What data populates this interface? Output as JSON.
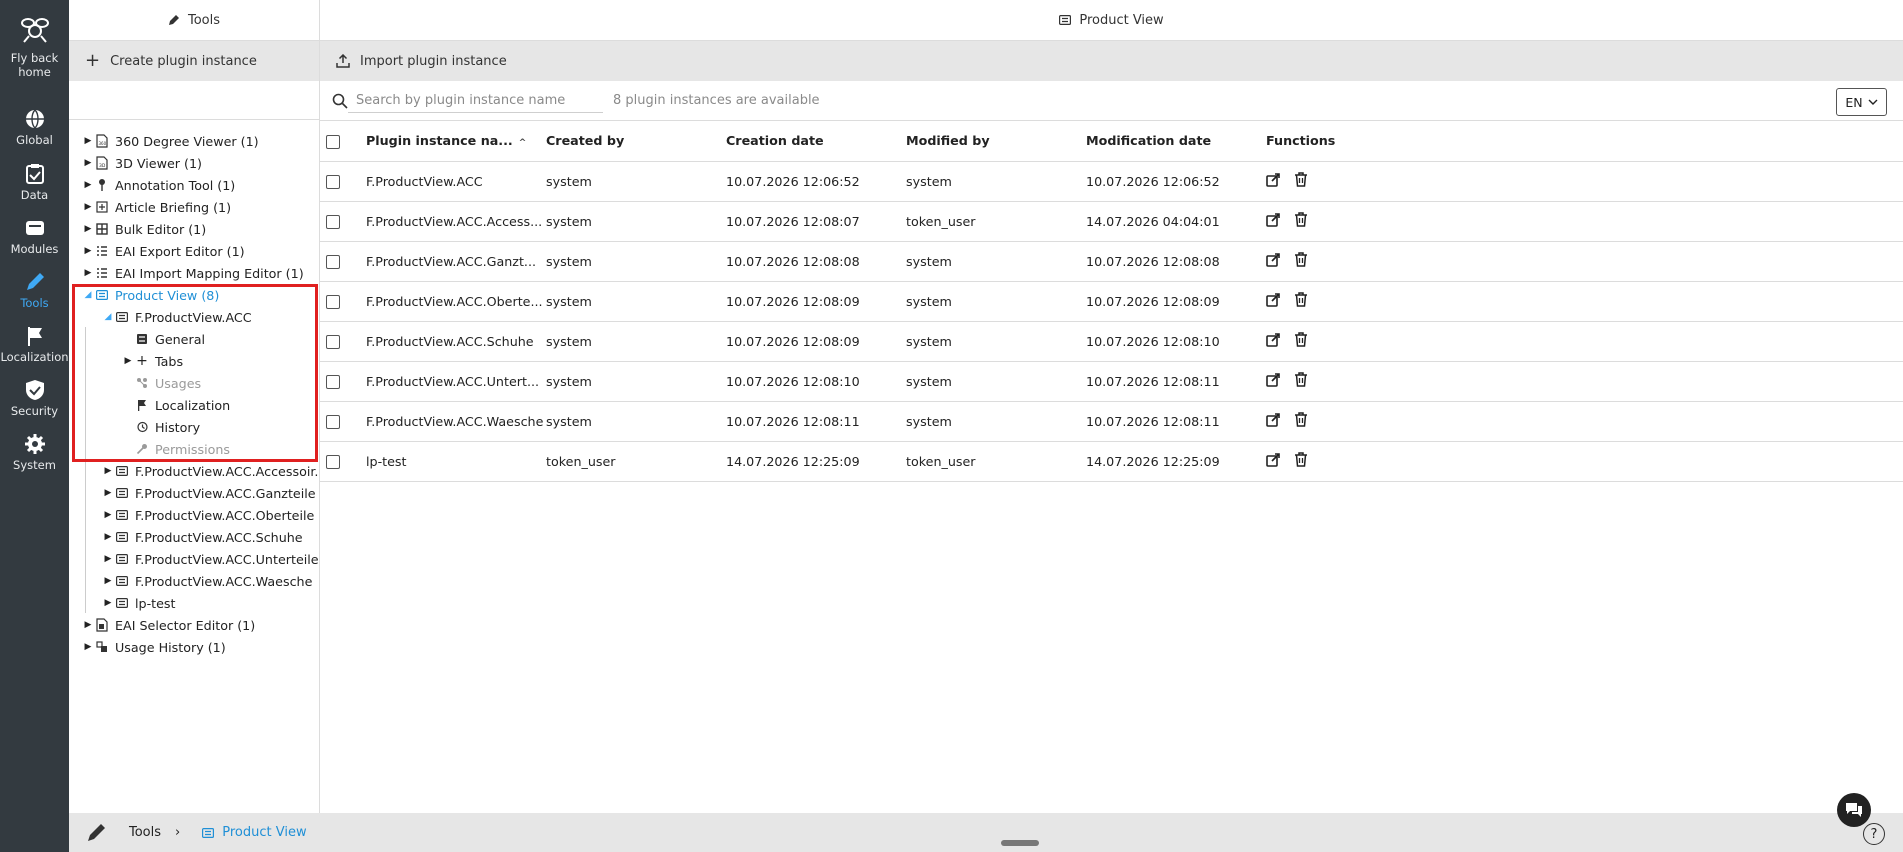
{
  "rail": [
    {
      "label": "Fly back home",
      "icon": "bee-logo-icon"
    },
    {
      "label": "Global",
      "icon": "globe-icon"
    },
    {
      "label": "Data",
      "icon": "clipboard-check-icon"
    },
    {
      "label": "Modules",
      "icon": "module-card-icon"
    },
    {
      "label": "Tools",
      "icon": "pencil-icon",
      "active": true
    },
    {
      "label": "Localization",
      "icon": "flag-icon"
    },
    {
      "label": "Security",
      "icon": "shield-check-icon"
    },
    {
      "label": "System",
      "icon": "gear-icon"
    }
  ],
  "tree_panel": {
    "title": "Tools",
    "create_label": "Create plugin instance",
    "items": [
      {
        "label": "360 Degree Viewer (1)",
        "icon": "file-icon"
      },
      {
        "label": "3D Viewer (1)",
        "icon": "file-3d-icon"
      },
      {
        "label": "Annotation Tool (1)",
        "icon": "pin-icon"
      },
      {
        "label": "Article Briefing (1)",
        "icon": "briefing-icon"
      },
      {
        "label": "Bulk Editor (1)",
        "icon": "table-icon"
      },
      {
        "label": "EAI Export Editor (1)",
        "icon": "list-icon"
      },
      {
        "label": "EAI Import Mapping Editor (1)",
        "icon": "list-icon"
      },
      {
        "label": "Product View (8)",
        "icon": "product-view-icon"
      },
      {
        "label": "F.ProductView.ACC",
        "icon": "product-view-icon"
      },
      {
        "label": "General",
        "icon": "general-icon"
      },
      {
        "label": "Tabs",
        "icon": "plus-icon"
      },
      {
        "label": "Usages",
        "icon": "usages-icon"
      },
      {
        "label": "Localization",
        "icon": "flag-icon"
      },
      {
        "label": "History",
        "icon": "history-icon"
      },
      {
        "label": "Permissions",
        "icon": "key-icon"
      },
      {
        "label": "F.ProductView.ACC.Accessoir.",
        "icon": "product-view-icon"
      },
      {
        "label": "F.ProductView.ACC.Ganzteile",
        "icon": "product-view-icon"
      },
      {
        "label": "F.ProductView.ACC.Oberteile",
        "icon": "product-view-icon"
      },
      {
        "label": "F.ProductView.ACC.Schuhe",
        "icon": "product-view-icon"
      },
      {
        "label": "F.ProductView.ACC.Unterteile",
        "icon": "product-view-icon"
      },
      {
        "label": "F.ProductView.ACC.Waesche",
        "icon": "product-view-icon"
      },
      {
        "label": "lp-test",
        "icon": "product-view-icon"
      },
      {
        "label": "EAI Selector Editor (1)",
        "icon": "selector-icon"
      },
      {
        "label": "Usage History (1)",
        "icon": "usage-history-icon"
      }
    ]
  },
  "main": {
    "title": "Product View",
    "import_label": "Import plugin instance",
    "search_placeholder": "Search by plugin instance name",
    "count_text": "8 plugin instances are available",
    "language": "EN",
    "columns": [
      "Plugin instance na...",
      "Created by",
      "Creation date",
      "Modified by",
      "Modification date",
      "Functions"
    ],
    "rows": [
      [
        "F.ProductView.ACC",
        "system",
        "10.07.2026 12:06:52",
        "system",
        "10.07.2026 12:06:52"
      ],
      [
        "F.ProductView.ACC.Access...",
        "system",
        "10.07.2026 12:08:07",
        "token_user",
        "14.07.2026 04:04:01"
      ],
      [
        "F.ProductView.ACC.Ganzt...",
        "system",
        "10.07.2026 12:08:08",
        "system",
        "10.07.2026 12:08:08"
      ],
      [
        "F.ProductView.ACC.Oberte...",
        "system",
        "10.07.2026 12:08:09",
        "system",
        "10.07.2026 12:08:09"
      ],
      [
        "F.ProductView.ACC.Schuhe",
        "system",
        "10.07.2026 12:08:09",
        "system",
        "10.07.2026 12:08:10"
      ],
      [
        "F.ProductView.ACC.Untert...",
        "system",
        "10.07.2026 12:08:10",
        "system",
        "10.07.2026 12:08:11"
      ],
      [
        "F.ProductView.ACC.Waesche",
        "system",
        "10.07.2026 12:08:11",
        "system",
        "10.07.2026 12:08:11"
      ],
      [
        "lp-test",
        "token_user",
        "14.07.2026 12:25:09",
        "token_user",
        "14.07.2026 12:25:09"
      ]
    ]
  },
  "footer": {
    "crumb_root": "Tools",
    "crumb_current": "Product View"
  },
  "colors": {
    "rail_bg": "#333a40",
    "accent": "#1f8fd6",
    "highlight": "#e02020"
  }
}
